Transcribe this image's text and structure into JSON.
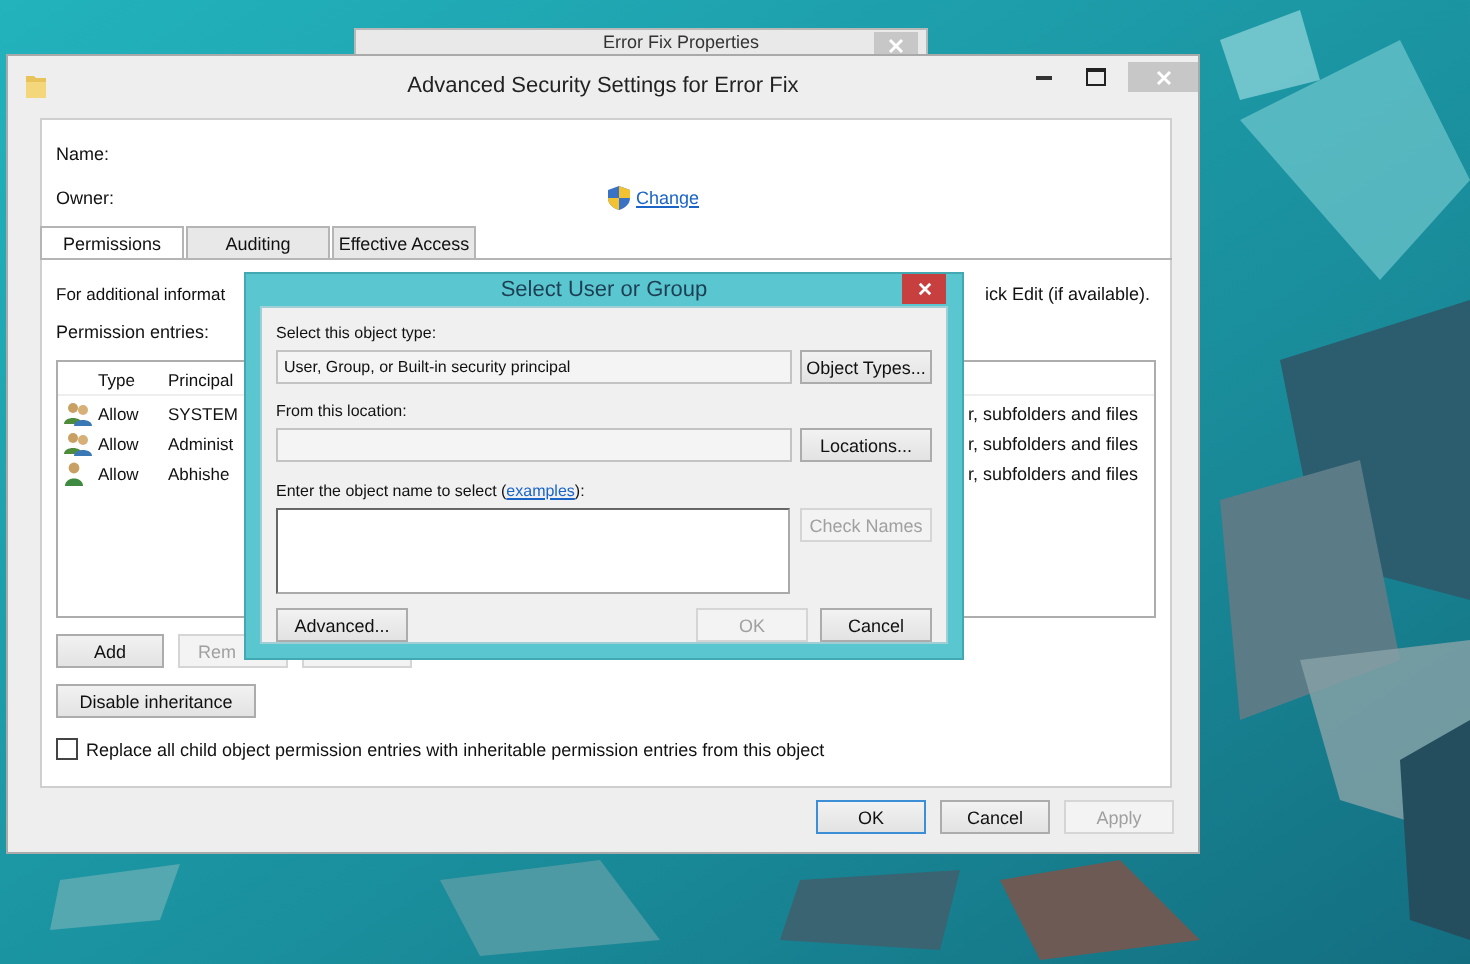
{
  "back_window": {
    "title": "Error Fix Properties"
  },
  "window": {
    "title": "Advanced Security Settings for Error Fix"
  },
  "fields": [
    {
      "label": "Name:"
    },
    {
      "label": "Owner:"
    }
  ],
  "change_link": "Change",
  "tabs": [
    {
      "label": "Permissions",
      "selected": true
    },
    {
      "label": "Auditing",
      "selected": false
    },
    {
      "label": "Effective Access",
      "selected": false
    }
  ],
  "info_text_start": "For additional informat",
  "info_text_end": "ick Edit (if available).",
  "entries_label": "Permission entries:",
  "table": {
    "columns": [
      "Type",
      "Principal"
    ],
    "rows": [
      {
        "kind": "group",
        "type": "Allow",
        "principal": "SYSTEM",
        "applies_to": "r, subfolders and files"
      },
      {
        "kind": "group",
        "type": "Allow",
        "principal": "Administ",
        "applies_to": "r, subfolders and files"
      },
      {
        "kind": "user",
        "type": "Allow",
        "principal": "Abhishe",
        "applies_to": "r, subfolders and files"
      }
    ]
  },
  "list_buttons": [
    {
      "label": "Add",
      "disabled": false
    },
    {
      "label": "Rem",
      "disabled": true
    },
    {
      "disabled": true
    }
  ],
  "disable_inheritance": "Disable inheritance",
  "replace_checkbox": {
    "label": "Replace all child object permission entries with inheritable permission entries from this object",
    "checked": false
  },
  "footer_buttons": [
    {
      "label": "OK",
      "disabled": false
    },
    {
      "label": "Cancel",
      "disabled": false
    },
    {
      "label": "Apply",
      "disabled": true
    }
  ],
  "dialog": {
    "title": "Select User or Group",
    "object_type_label": "Select this object type:",
    "object_type_value": "User, Group, or Built-in security principal",
    "object_types_button": "Object Types...",
    "location_label": "From this location:",
    "locations_button": "Locations...",
    "name_label_start": "Enter the object name to select (",
    "examples_link": "examples",
    "name_label_end": "):",
    "check_names": {
      "label": "Check Names",
      "disabled": true
    },
    "advanced_button": "Advanced...",
    "ok": {
      "label": "OK",
      "disabled": true
    },
    "cancel_button": "Cancel"
  }
}
